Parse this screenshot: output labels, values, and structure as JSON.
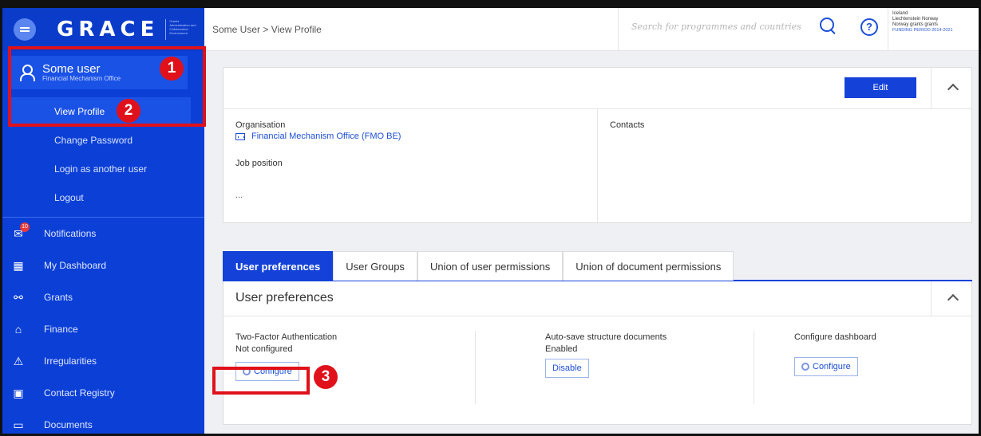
{
  "brand": {
    "name": "GRACE",
    "tagline": "Grants Administration and Collaboration Environment"
  },
  "user": {
    "name": "Some user",
    "organisation": "Financial Mechanism Office"
  },
  "user_menu": [
    {
      "label": "View Profile",
      "active": true
    },
    {
      "label": "Change Password"
    },
    {
      "label": "Login as another user"
    },
    {
      "label": "Logout"
    }
  ],
  "nav": [
    {
      "label": "Notifications",
      "icon": "envelope-icon",
      "badge": "10"
    },
    {
      "label": "My Dashboard",
      "icon": "grid-icon"
    },
    {
      "label": "Grants",
      "icon": "grants-icon"
    },
    {
      "label": "Finance",
      "icon": "bank-icon"
    },
    {
      "label": "Irregularities",
      "icon": "warning-icon"
    },
    {
      "label": "Contact Registry",
      "icon": "contact-icon"
    },
    {
      "label": "Documents",
      "icon": "folder-icon"
    }
  ],
  "header": {
    "breadcrumb": "Some User > View Profile",
    "search_placeholder": "Search for programmes and countries",
    "help": "?",
    "funder_logo": {
      "line1": "Iceland",
      "line2": "Liechtenstein  Norway",
      "line3": "Norway grants   grants",
      "period": "FUNDING PERIOD 2014-2021"
    }
  },
  "profile": {
    "edit_label": "Edit",
    "organisation_label": "Organisation",
    "organisation_value": "Financial Mechanism Office (FMO BE)",
    "job_position_label": "Job position",
    "job_position_value": "...",
    "contacts_label": "Contacts"
  },
  "tabs": [
    {
      "label": "User preferences",
      "active": true
    },
    {
      "label": "User Groups"
    },
    {
      "label": "Union of user permissions"
    },
    {
      "label": "Union of document permissions"
    }
  ],
  "preferences": {
    "title": "User preferences",
    "two_factor": {
      "label": "Two-Factor Authentication",
      "status": "Not configured",
      "button": "Configure"
    },
    "autosave": {
      "label": "Auto-save structure documents",
      "status": "Enabled",
      "button": "Disable"
    },
    "dashboard": {
      "label": "Configure dashboard",
      "button": "Configure"
    }
  },
  "callouts": [
    "1",
    "2",
    "3"
  ],
  "colors": {
    "sidebar": "#0b3fd6",
    "accent": "#1442d8",
    "callout": "#e0111a"
  }
}
